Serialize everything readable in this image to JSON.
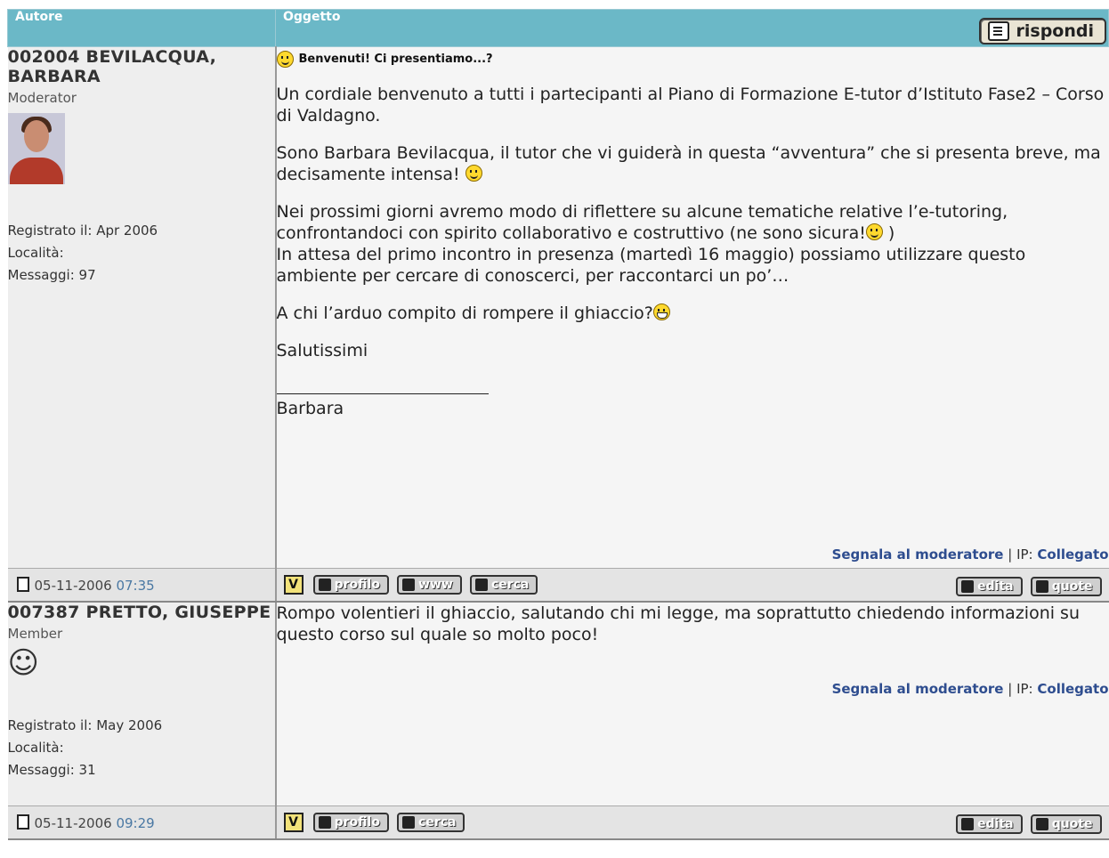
{
  "header": {
    "autore": "Autore",
    "oggetto": "Oggetto",
    "reply_label": "rispondi"
  },
  "posts": [
    {
      "author": "002004 BEVILACQUA, BARBARA",
      "rank": "Moderator",
      "registered": "Registrato il: Apr 2006",
      "location": "Località:",
      "messages": "Messaggi: 97",
      "subject": "Benvenuti! Ci presentiamo...?",
      "paragraphs": [
        "Un cordiale benvenuto a tutti i partecipanti al Piano di Formazione E-tutor d’Istituto Fase2 – Corso di Valdagno.",
        "Sono Barbara Bevilacqua, il tutor che vi guiderà in questa “avventura” che si presenta breve, ma decisamente intensa!",
        "Nei prossimi giorni avremo modo di riflettere su alcune tematiche relative l’e-tutoring, confrontandoci con spirito collaborativo e costruttivo (ne sono sicura!",
        ")",
        "In attesa del primo incontro in presenza (martedì 16 maggio) possiamo utilizzare questo ambiente per cercare di conoscerci, per raccontarci un po’…",
        "A chi l’arduo compito di rompere il ghiaccio?",
        "Salutissimi",
        "Barbara"
      ],
      "report": "Segnala al moderatore",
      "ip_label": "IP:",
      "ip_value": "Collegato",
      "date": "05-11-2006",
      "time": "07:35",
      "buttons": {
        "v": "V",
        "profilo": "profilo",
        "www": "www",
        "cerca": "cerca",
        "edita": "edita",
        "quote": "quote"
      }
    },
    {
      "author": "007387 PRETTO, GIUSEPPE",
      "rank": "Member",
      "registered": "Registrato il: May 2006",
      "location": "Località:",
      "messages": "Messaggi: 31",
      "paragraphs": [
        "Rompo volentieri il ghiaccio, salutando chi mi legge, ma soprattutto chiedendo informazioni su questo corso sul quale so molto poco!"
      ],
      "report": "Segnala al moderatore",
      "ip_label": "IP:",
      "ip_value": "Collegato",
      "date": "05-11-2006",
      "time": "09:29",
      "buttons": {
        "v": "V",
        "profilo": "profilo",
        "cerca": "cerca",
        "edita": "edita",
        "quote": "quote"
      }
    }
  ]
}
